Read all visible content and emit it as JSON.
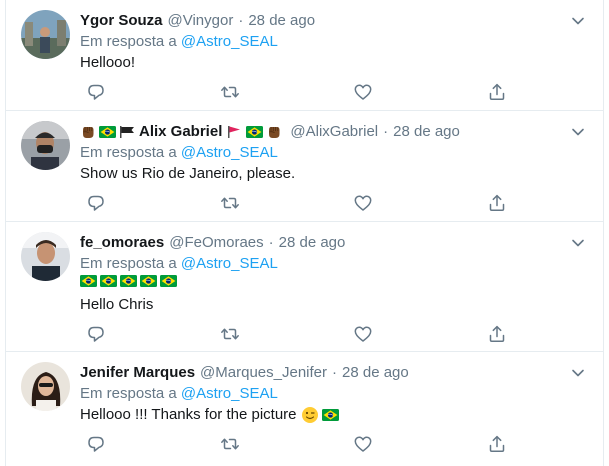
{
  "reply_prefix": "Em resposta a",
  "colors": {
    "name": "#14171a",
    "secondary": "#657786",
    "link": "#1da1f2",
    "divider": "#e6ecf0",
    "icon": "#657786"
  },
  "tweets": [
    {
      "name": "Ygor Souza",
      "handle": "@Vinygor",
      "dot": "·",
      "date": "28 de ago",
      "mention": "@Astro_SEAL",
      "text": "Hellooo!"
    },
    {
      "name": "Alix Gabriel",
      "handle": "@AlixGabriel",
      "dot": "·",
      "date": "28 de ago",
      "mention": "@Astro_SEAL",
      "text": "Show us Rio de Janeiro, please.",
      "name_emoji": [
        "raised-fist-dark-icon",
        "brazil-flag-icon",
        "black-flag-icon",
        "red-flag-icon",
        "brazil-flag-icon",
        "raised-fist-dark-icon"
      ]
    },
    {
      "name": "fe_omoraes",
      "handle": "@FeOmoraes",
      "dot": "·",
      "date": "28 de ago",
      "mention": "@Astro_SEAL",
      "flags_line": [
        "brazil-flag-icon",
        "brazil-flag-icon",
        "brazil-flag-icon",
        "brazil-flag-icon",
        "brazil-flag-icon"
      ],
      "text": "Hello Chris"
    },
    {
      "name": "Jenifer Marques",
      "handle": "@Marques_Jenifer",
      "dot": "·",
      "date": "28 de ago",
      "mention": "@Astro_SEAL",
      "text": "Hellooo !!! Thanks for the picture",
      "text_emoji": [
        "winking-face-icon",
        "brazil-flag-icon"
      ]
    }
  ],
  "action_icons": [
    "reply-icon",
    "retweet-icon",
    "like-icon",
    "share-icon"
  ]
}
